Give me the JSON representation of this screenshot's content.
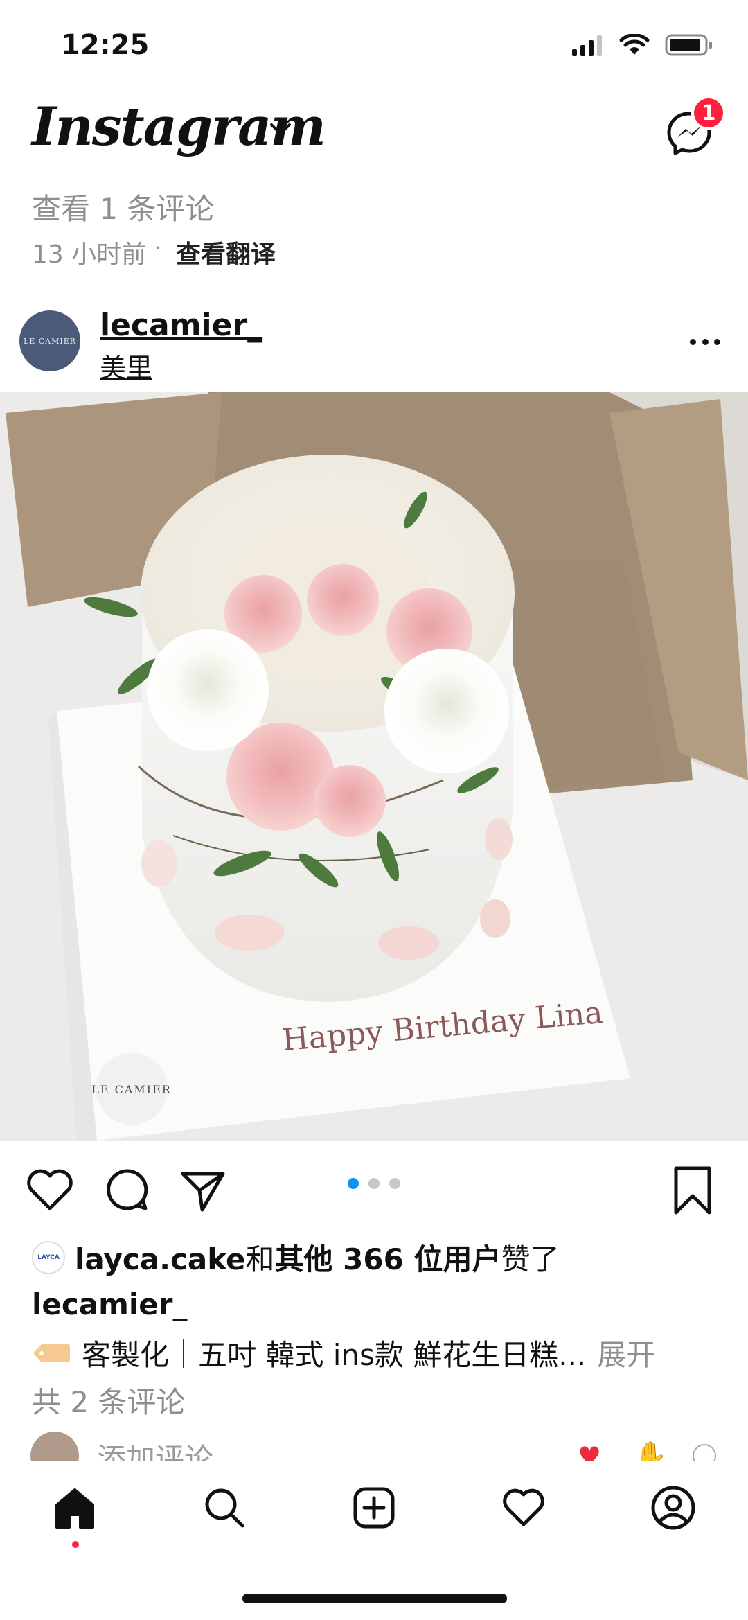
{
  "status_bar": {
    "time": "12:25",
    "icons": [
      "signal-icon",
      "wifi-icon",
      "battery-icon"
    ]
  },
  "header": {
    "logo": "Instagram",
    "messages_badge": "1"
  },
  "previous_post": {
    "view_comments": "查看 1 条评论",
    "time": "13 小时前",
    "separator": "·",
    "translate": "查看翻译"
  },
  "post": {
    "username": "lecamier_",
    "location": "美里",
    "avatar_text": "LE CAMIER",
    "image": {
      "cake_message": "Happy Birthday Lina",
      "watermark": "LE CAMIER"
    },
    "carousel": {
      "count": 3,
      "active": 0
    },
    "likes": {
      "liker": "layca.cake",
      "joiner": "和",
      "others": "其他 366 位用户",
      "suffix": "赞了",
      "liker_avatar_text": "LAYCA"
    },
    "caption_user": "lecamier_",
    "caption": "客製化｜五吋 韓式 ins款 鮮花生日糕...",
    "caption_more": "展开",
    "comments_link": "共 2 条评论",
    "add_comment_placeholder": "添加评论..."
  },
  "colors": {
    "accent_blue": "#0a95f6",
    "badge_red": "#ff1f3d",
    "muted": "#8e8e8e"
  },
  "tabbar": [
    "home-icon",
    "search-icon",
    "create-icon",
    "activity-icon",
    "profile-icon"
  ]
}
